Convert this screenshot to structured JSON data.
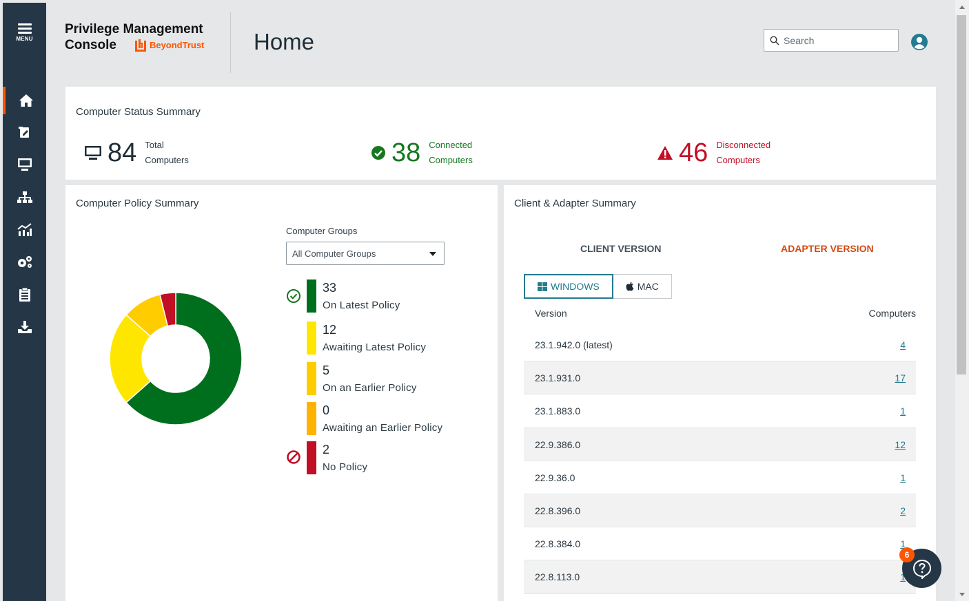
{
  "sidebar": {
    "menu_label": "MENU",
    "items": [
      {
        "name": "home-icon",
        "active": true
      },
      {
        "name": "policy-edit-icon",
        "active": false
      },
      {
        "name": "computer-icon",
        "active": false
      },
      {
        "name": "hierarchy-icon",
        "active": false
      },
      {
        "name": "analytics-icon",
        "active": false
      },
      {
        "name": "settings-icon",
        "active": false
      },
      {
        "name": "clipboard-icon",
        "active": false
      },
      {
        "name": "inbox-download-icon",
        "active": false
      }
    ]
  },
  "header": {
    "app_title_line1": "Privilege Management",
    "app_title_line2": "Console",
    "brand_name": "BeyondTrust",
    "page_title": "Home",
    "search_placeholder": "Search"
  },
  "status_summary": {
    "title": "Computer Status Summary",
    "total": {
      "value": "84",
      "label1": "Total",
      "label2": "Computers"
    },
    "connected": {
      "value": "38",
      "label1": "Connected",
      "label2": "Computers"
    },
    "disconnected": {
      "value": "46",
      "label1": "Disconnected",
      "label2": "Computers"
    }
  },
  "policy_summary": {
    "title": "Computer Policy Summary",
    "groups_label": "Computer Groups",
    "groups_selected": "All Computer Groups",
    "legend": [
      {
        "value": "33",
        "label": "On Latest Policy",
        "color": "#006f1d"
      },
      {
        "value": "12",
        "label": "Awaiting Latest Policy",
        "color": "#ffe600"
      },
      {
        "value": "5",
        "label": "On an Earlier Policy",
        "color": "#ffcc00"
      },
      {
        "value": "0",
        "label": "Awaiting an Earlier Policy",
        "color": "#ffb300"
      },
      {
        "value": "2",
        "label": "No Policy",
        "color": "#c10f25"
      }
    ]
  },
  "chart_data": {
    "type": "pie",
    "categories": [
      "On Latest Policy",
      "Awaiting Latest Policy",
      "On an Earlier Policy",
      "Awaiting an Earlier Policy",
      "No Policy"
    ],
    "values": [
      33,
      12,
      5,
      0,
      2
    ],
    "colors": [
      "#006f1d",
      "#ffe600",
      "#ffcc00",
      "#ffb300",
      "#c10f25"
    ],
    "donut": true
  },
  "client_summary": {
    "title": "Client & Adapter Summary",
    "tab_client": "CLIENT VERSION",
    "tab_adapter": "ADAPTER VERSION",
    "os_windows": "WINDOWS",
    "os_mac": "MAC",
    "col_version": "Version",
    "col_computers": "Computers",
    "rows": [
      {
        "version": "23.1.942.0 (latest)",
        "computers": "4"
      },
      {
        "version": "23.1.931.0",
        "computers": "17"
      },
      {
        "version": "23.1.883.0",
        "computers": "1"
      },
      {
        "version": "22.9.386.0",
        "computers": "12"
      },
      {
        "version": "22.9.36.0",
        "computers": "1"
      },
      {
        "version": "22.8.396.0",
        "computers": "2"
      },
      {
        "version": "22.8.384.0",
        "computers": "1"
      },
      {
        "version": "22.8.113.0",
        "computers": "1"
      }
    ]
  },
  "help": {
    "badge_count": "6"
  },
  "colors": {
    "sidebar": "#253746",
    "accent": "#ff5500",
    "teal": "#237b8f",
    "green": "#16781e",
    "red": "#c10f25"
  }
}
